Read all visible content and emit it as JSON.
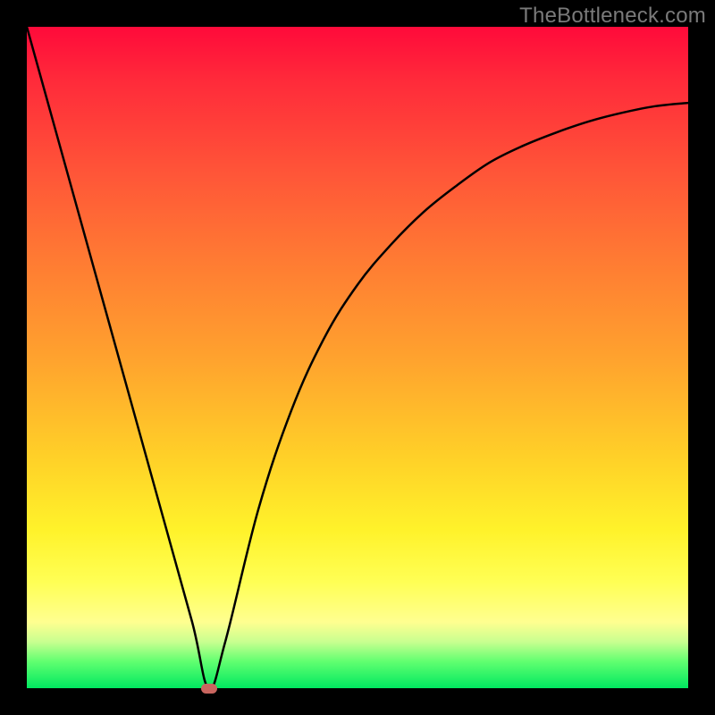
{
  "watermark": "TheBottleneck.com",
  "chart_data": {
    "type": "line",
    "title": "",
    "xlabel": "",
    "ylabel": "",
    "xlim": [
      0,
      100
    ],
    "ylim": [
      0,
      100
    ],
    "grid": false,
    "legend": false,
    "series": [
      {
        "name": "curve",
        "x": [
          0,
          5,
          10,
          15,
          20,
          25,
          27.5,
          30,
          35,
          40,
          45,
          50,
          55,
          60,
          65,
          70,
          75,
          80,
          85,
          90,
          95,
          100
        ],
        "y": [
          100,
          82,
          64,
          46,
          28,
          10,
          0,
          7,
          27,
          42,
          53,
          61,
          67,
          72,
          76,
          79.5,
          82,
          84,
          85.7,
          87,
          88,
          88.5
        ]
      }
    ],
    "min_point": {
      "x": 27.5,
      "y": 0
    },
    "background_gradient": {
      "top": "#ff0a3a",
      "mid": "#ffd028",
      "bottom": "#00e860"
    },
    "curve_color": "#000000",
    "min_marker_color": "#c9655f"
  }
}
